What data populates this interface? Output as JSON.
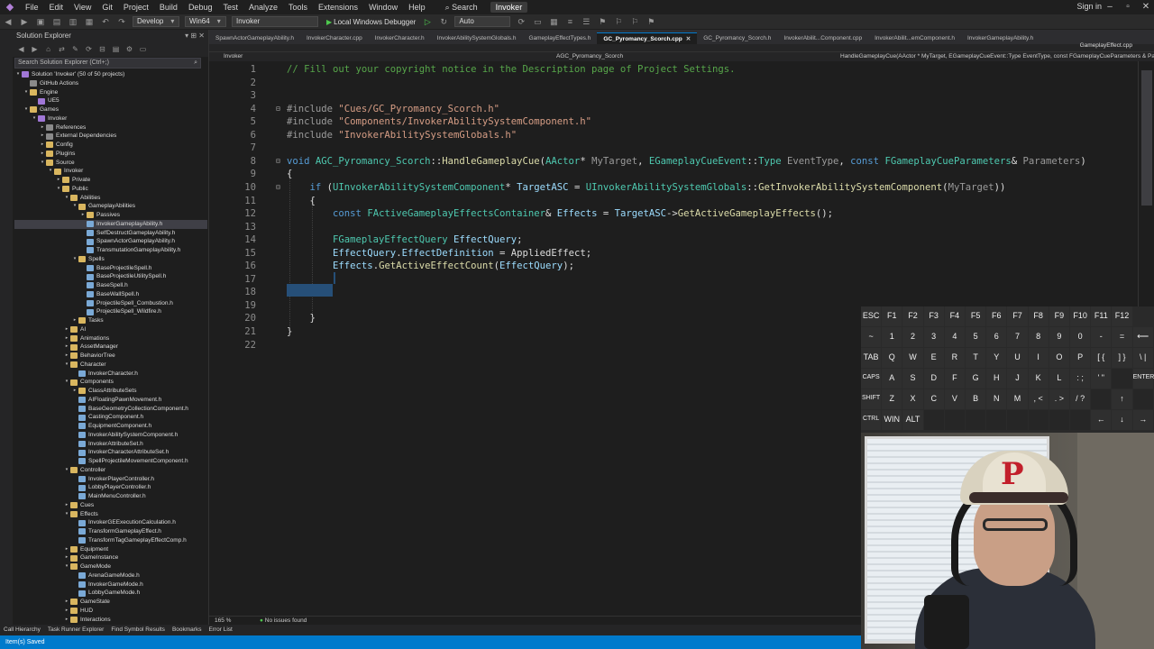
{
  "menu": {
    "items": [
      "File",
      "Edit",
      "View",
      "Git",
      "Project",
      "Build",
      "Debug",
      "Test",
      "Analyze",
      "Tools",
      "Extensions",
      "Window",
      "Help"
    ],
    "search_label": "Search",
    "solution_name": "Invoker",
    "sign_in": "Sign in"
  },
  "toolbar": {
    "config": "Develop",
    "platform": "Win64",
    "project": "Invoker",
    "debugger": "Local Windows Debugger",
    "auto": "Auto"
  },
  "solution_explorer": {
    "title": "Solution Explorer",
    "search_placeholder": "Search Solution Explorer (Ctrl+;)",
    "items": [
      {
        "label": "Solution 'Invoker' (50 of 50 projects)",
        "depth": 0,
        "icon": "proj",
        "arrow": "▾"
      },
      {
        "label": "GitHub Actions",
        "depth": 1,
        "icon": "ref",
        "arrow": ""
      },
      {
        "label": "Engine",
        "depth": 1,
        "icon": "folder",
        "arrow": "▾"
      },
      {
        "label": "UE5",
        "depth": 2,
        "icon": "proj",
        "arrow": ""
      },
      {
        "label": "Games",
        "depth": 1,
        "icon": "folder",
        "arrow": "▾"
      },
      {
        "label": "Invoker",
        "depth": 2,
        "icon": "proj",
        "arrow": "▾"
      },
      {
        "label": "References",
        "depth": 3,
        "icon": "ref",
        "arrow": "▸"
      },
      {
        "label": "External Dependencies",
        "depth": 3,
        "icon": "ref",
        "arrow": "▸"
      },
      {
        "label": "Config",
        "depth": 3,
        "icon": "folder",
        "arrow": "▸"
      },
      {
        "label": "Plugins",
        "depth": 3,
        "icon": "folder",
        "arrow": "▸"
      },
      {
        "label": "Source",
        "depth": 3,
        "icon": "folder",
        "arrow": "▾"
      },
      {
        "label": "Invoker",
        "depth": 4,
        "icon": "folder",
        "arrow": "▾"
      },
      {
        "label": "Private",
        "depth": 5,
        "icon": "folder",
        "arrow": "▸"
      },
      {
        "label": "Public",
        "depth": 5,
        "icon": "folder",
        "arrow": "▾"
      },
      {
        "label": "Abilities",
        "depth": 6,
        "icon": "folder",
        "arrow": "▾"
      },
      {
        "label": "GameplayAbilities",
        "depth": 7,
        "icon": "folder",
        "arrow": "▾"
      },
      {
        "label": "Passives",
        "depth": 8,
        "icon": "folder",
        "arrow": "▸"
      },
      {
        "label": "InvokerGameplayAbility.h",
        "depth": 8,
        "icon": "file",
        "arrow": "",
        "selected": true
      },
      {
        "label": "SelfDestructGameplayAbility.h",
        "depth": 8,
        "icon": "file",
        "arrow": ""
      },
      {
        "label": "SpawnActorGameplayAbility.h",
        "depth": 8,
        "icon": "file",
        "arrow": ""
      },
      {
        "label": "TransmutationGameplayAbility.h",
        "depth": 8,
        "icon": "file",
        "arrow": ""
      },
      {
        "label": "Spells",
        "depth": 7,
        "icon": "folder",
        "arrow": "▾"
      },
      {
        "label": "BaseProjectileSpell.h",
        "depth": 8,
        "icon": "file",
        "arrow": ""
      },
      {
        "label": "BaseProjectileUtilitySpell.h",
        "depth": 8,
        "icon": "file",
        "arrow": ""
      },
      {
        "label": "BaseSpell.h",
        "depth": 8,
        "icon": "file",
        "arrow": ""
      },
      {
        "label": "BaseWallSpell.h",
        "depth": 8,
        "icon": "file",
        "arrow": ""
      },
      {
        "label": "ProjectileSpell_Combustion.h",
        "depth": 8,
        "icon": "file",
        "arrow": ""
      },
      {
        "label": "ProjectileSpell_Wildfire.h",
        "depth": 8,
        "icon": "file",
        "arrow": ""
      },
      {
        "label": "Tasks",
        "depth": 7,
        "icon": "folder",
        "arrow": "▸"
      },
      {
        "label": "AI",
        "depth": 6,
        "icon": "folder",
        "arrow": "▸"
      },
      {
        "label": "Animations",
        "depth": 6,
        "icon": "folder",
        "arrow": "▸"
      },
      {
        "label": "AssetManager",
        "depth": 6,
        "icon": "folder",
        "arrow": "▸"
      },
      {
        "label": "BehaviorTree",
        "depth": 6,
        "icon": "folder",
        "arrow": "▸"
      },
      {
        "label": "Character",
        "depth": 6,
        "icon": "folder",
        "arrow": "▾"
      },
      {
        "label": "InvokerCharacter.h",
        "depth": 7,
        "icon": "file",
        "arrow": ""
      },
      {
        "label": "Components",
        "depth": 6,
        "icon": "folder",
        "arrow": "▾"
      },
      {
        "label": "ClassAttributeSets",
        "depth": 7,
        "icon": "folder",
        "arrow": "▸"
      },
      {
        "label": "AIFloatingPawnMovement.h",
        "depth": 7,
        "icon": "file",
        "arrow": ""
      },
      {
        "label": "BaseGeometryCollectionComponent.h",
        "depth": 7,
        "icon": "file",
        "arrow": ""
      },
      {
        "label": "CastingComponent.h",
        "depth": 7,
        "icon": "file",
        "arrow": ""
      },
      {
        "label": "EquipmentComponent.h",
        "depth": 7,
        "icon": "file",
        "arrow": ""
      },
      {
        "label": "InvokerAbilitySystemComponent.h",
        "depth": 7,
        "icon": "file",
        "arrow": ""
      },
      {
        "label": "InvokerAttributeSet.h",
        "depth": 7,
        "icon": "file",
        "arrow": ""
      },
      {
        "label": "InvokerCharacterAttributeSet.h",
        "depth": 7,
        "icon": "file",
        "arrow": ""
      },
      {
        "label": "SpellProjectileMovementComponent.h",
        "depth": 7,
        "icon": "file",
        "arrow": ""
      },
      {
        "label": "Controller",
        "depth": 6,
        "icon": "folder",
        "arrow": "▾"
      },
      {
        "label": "InvokerPlayerController.h",
        "depth": 7,
        "icon": "file",
        "arrow": ""
      },
      {
        "label": "LobbyPlayerController.h",
        "depth": 7,
        "icon": "file",
        "arrow": ""
      },
      {
        "label": "MainMenuController.h",
        "depth": 7,
        "icon": "file",
        "arrow": ""
      },
      {
        "label": "Cues",
        "depth": 6,
        "icon": "folder",
        "arrow": "▸"
      },
      {
        "label": "Effects",
        "depth": 6,
        "icon": "folder",
        "arrow": "▾"
      },
      {
        "label": "InvokerGEExecutionCalculation.h",
        "depth": 7,
        "icon": "file",
        "arrow": ""
      },
      {
        "label": "TransformGameplayEffect.h",
        "depth": 7,
        "icon": "file",
        "arrow": ""
      },
      {
        "label": "TransformTagGameplayEffectComp.h",
        "depth": 7,
        "icon": "file",
        "arrow": ""
      },
      {
        "label": "Equipment",
        "depth": 6,
        "icon": "folder",
        "arrow": "▸"
      },
      {
        "label": "GameInstance",
        "depth": 6,
        "icon": "folder",
        "arrow": "▸"
      },
      {
        "label": "GameMode",
        "depth": 6,
        "icon": "folder",
        "arrow": "▾"
      },
      {
        "label": "ArenaGameMode.h",
        "depth": 7,
        "icon": "file",
        "arrow": ""
      },
      {
        "label": "InvokerGameMode.h",
        "depth": 7,
        "icon": "file",
        "arrow": ""
      },
      {
        "label": "LobbyGameMode.h",
        "depth": 7,
        "icon": "file",
        "arrow": ""
      },
      {
        "label": "GameState",
        "depth": 6,
        "icon": "folder",
        "arrow": "▸"
      },
      {
        "label": "HUD",
        "depth": 6,
        "icon": "folder",
        "arrow": "▸"
      },
      {
        "label": "Interactions",
        "depth": 6,
        "icon": "folder",
        "arrow": "▸"
      }
    ]
  },
  "tabs": [
    {
      "label": "SpawnActorGameplayAbility.h",
      "active": false
    },
    {
      "label": "InvokerCharacter.cpp",
      "active": false
    },
    {
      "label": "InvokerCharacter.h",
      "active": false
    },
    {
      "label": "InvokerAbilitySystemGlobals.h",
      "active": false
    },
    {
      "label": "GameplayEffectTypes.h",
      "active": false
    },
    {
      "label": "GC_Pyromancy_Scorch.cpp",
      "active": true
    },
    {
      "label": "GC_Pyromancy_Scorch.h",
      "active": false
    },
    {
      "label": "InvokerAbilit...Component.cpp",
      "active": false
    },
    {
      "label": "InvokerAbilit...emComponent.h",
      "active": false
    },
    {
      "label": "InvokerGameplayAbility.h",
      "active": false
    }
  ],
  "extra_tab": "GameplayEffect.cpp",
  "nav": {
    "project": "Invoker",
    "file": "AGC_Pyromancy_Scorch",
    "function": "HandleGameplayCue(AActor * MyTarget, EGameplayCueEvent::Type EventType, const FGameplayCueParameters & Par..."
  },
  "code_lines": [
    {
      "n": "1",
      "tokens": [
        [
          "c-comment",
          "// Fill out your copyright notice in the Description page of Project Settings."
        ]
      ]
    },
    {
      "n": "2",
      "tokens": []
    },
    {
      "n": "3",
      "tokens": []
    },
    {
      "n": "4",
      "fold": "⊟",
      "tokens": [
        [
          "c-inc",
          "#include "
        ],
        [
          "c-str",
          "\"Cues/GC_Pyromancy_Scorch.h\""
        ]
      ]
    },
    {
      "n": "5",
      "tokens": [
        [
          "c-inc",
          "#include "
        ],
        [
          "c-str",
          "\"Components/InvokerAbilitySystemComponent.h\""
        ]
      ]
    },
    {
      "n": "6",
      "tokens": [
        [
          "c-inc",
          "#include "
        ],
        [
          "c-str",
          "\"InvokerAbilitySystemGlobals.h\""
        ]
      ]
    },
    {
      "n": "7",
      "tokens": []
    },
    {
      "n": "8",
      "fold": "⊟",
      "tokens": [
        [
          "c-kw",
          "void "
        ],
        [
          "c-type",
          "AGC_Pyromancy_Scorch"
        ],
        [
          "c-plain",
          "::"
        ],
        [
          "c-func",
          "HandleGameplayCue"
        ],
        [
          "c-plain",
          "("
        ],
        [
          "c-type",
          "AActor"
        ],
        [
          "c-plain",
          "* "
        ],
        [
          "c-param",
          "MyTarget"
        ],
        [
          "c-plain",
          ", "
        ],
        [
          "c-type",
          "EGameplayCueEvent"
        ],
        [
          "c-plain",
          "::"
        ],
        [
          "c-type",
          "Type "
        ],
        [
          "c-param",
          "EventType"
        ],
        [
          "c-plain",
          ", "
        ],
        [
          "c-kw",
          "const "
        ],
        [
          "c-type",
          "FGameplayCueParameters"
        ],
        [
          "c-plain",
          "& "
        ],
        [
          "c-param",
          "Parameters"
        ],
        [
          "c-plain",
          ")"
        ]
      ]
    },
    {
      "n": "9",
      "tokens": [
        [
          "c-plain",
          "{"
        ]
      ]
    },
    {
      "n": "10",
      "fold": "⊟",
      "tokens": [
        [
          "c-plain",
          "    "
        ],
        [
          "c-kw",
          "if "
        ],
        [
          "c-plain",
          "("
        ],
        [
          "c-type",
          "UInvokerAbilitySystemComponent"
        ],
        [
          "c-plain",
          "* "
        ],
        [
          "c-var",
          "TargetASC"
        ],
        [
          "c-plain",
          " = "
        ],
        [
          "c-type",
          "UInvokerAbilitySystemGlobals"
        ],
        [
          "c-plain",
          "::"
        ],
        [
          "c-func",
          "GetInvokerAbilitySystemComponent"
        ],
        [
          "c-plain",
          "("
        ],
        [
          "c-param",
          "MyTarget"
        ],
        [
          "c-plain",
          "))"
        ]
      ]
    },
    {
      "n": "11",
      "tokens": [
        [
          "c-plain",
          "    {"
        ]
      ]
    },
    {
      "n": "12",
      "tokens": [
        [
          "c-plain",
          "        "
        ],
        [
          "c-kw",
          "const "
        ],
        [
          "c-type",
          "FActiveGameplayEffectsContainer"
        ],
        [
          "c-plain",
          "& "
        ],
        [
          "c-var",
          "Effects"
        ],
        [
          "c-plain",
          " = "
        ],
        [
          "c-var",
          "TargetASC"
        ],
        [
          "c-plain",
          "->"
        ],
        [
          "c-func",
          "GetActiveGameplayEffects"
        ],
        [
          "c-plain",
          "();"
        ]
      ]
    },
    {
      "n": "13",
      "tokens": []
    },
    {
      "n": "14",
      "tokens": [
        [
          "c-plain",
          "        "
        ],
        [
          "c-type",
          "FGameplayEffectQuery "
        ],
        [
          "c-var",
          "EffectQuery"
        ],
        [
          "c-plain",
          ";"
        ]
      ]
    },
    {
      "n": "15",
      "tokens": [
        [
          "c-plain",
          "        "
        ],
        [
          "c-var",
          "EffectQuery"
        ],
        [
          "c-plain",
          "."
        ],
        [
          "c-var",
          "EffectDefinition"
        ],
        [
          "c-plain",
          " = AppliedEffect;"
        ]
      ]
    },
    {
      "n": "16",
      "tokens": [
        [
          "c-plain",
          "        "
        ],
        [
          "c-var",
          "Effects"
        ],
        [
          "c-plain",
          "."
        ],
        [
          "c-func",
          "GetActiveEffectCount"
        ],
        [
          "c-plain",
          "("
        ],
        [
          "c-var",
          "EffectQuery"
        ],
        [
          "c-plain",
          ");"
        ]
      ]
    },
    {
      "n": "17",
      "tokens": []
    },
    {
      "n": "18",
      "tokens": []
    },
    {
      "n": "19",
      "tokens": []
    },
    {
      "n": "20",
      "tokens": [
        [
          "c-plain",
          "    }"
        ]
      ]
    },
    {
      "n": "21",
      "tokens": [
        [
          "c-plain",
          "}"
        ]
      ]
    },
    {
      "n": "22",
      "tokens": []
    }
  ],
  "editor_status": {
    "zoom": "165 %",
    "issues": "No issues found"
  },
  "bottom_tabs": [
    "Call Hierarchy",
    "Task Runner Explorer",
    "Find Symbol Results",
    "Bookmarks",
    "Error List"
  ],
  "status_bar": "Item(s) Saved",
  "keyboard": {
    "rows": [
      [
        "ESC",
        "F1",
        "F2",
        "F3",
        "F4",
        "F5",
        "F6",
        "F7",
        "F8",
        "F9",
        "F10",
        "F11",
        "F12"
      ],
      [
        "~",
        "1",
        "2",
        "3",
        "4",
        "5",
        "6",
        "7",
        "8",
        "9",
        "0",
        "-",
        "=",
        "⟵"
      ],
      [
        "TAB",
        "Q",
        "W",
        "E",
        "R",
        "T",
        "Y",
        "U",
        "I",
        "O",
        "P",
        "[ {",
        "] }",
        "\\ |"
      ],
      [
        "CAPS",
        "A",
        "S",
        "D",
        "F",
        "G",
        "H",
        "J",
        "K",
        "L",
        ": ;",
        "' \"",
        "",
        "ENTER"
      ],
      [
        "SHIFT",
        "Z",
        "X",
        "C",
        "V",
        "B",
        "N",
        "M",
        ", <",
        ". >",
        "/ ?",
        "",
        "↑",
        ""
      ],
      [
        "CTRL",
        "WIN",
        "ALT",
        "",
        "",
        "",
        "",
        "",
        "",
        "",
        "",
        "←",
        "↓",
        "→"
      ]
    ]
  },
  "webcam": {
    "cap_logo": "P"
  }
}
